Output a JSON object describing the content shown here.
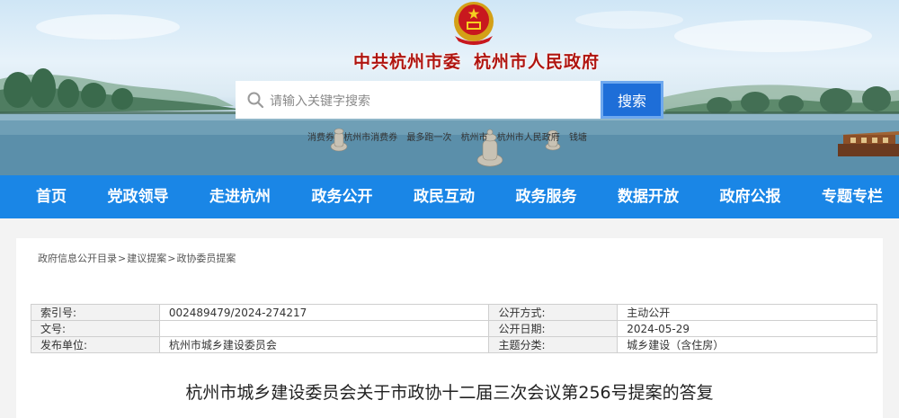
{
  "header": {
    "title_part1": "中共杭州市委",
    "title_part2": "杭州市人民政府"
  },
  "search": {
    "placeholder": "请输入关键字搜索",
    "button_label": "搜索",
    "hot_words": [
      "消费券",
      "杭州市消费券",
      "最多跑一次",
      "杭州市",
      "杭州市人民政府",
      "钱塘"
    ]
  },
  "nav": {
    "items": [
      "首页",
      "党政领导",
      "走进杭州",
      "政务公开",
      "政民互动",
      "政务服务",
      "数据开放",
      "政府公报",
      "专题专栏"
    ]
  },
  "breadcrumb": {
    "items": [
      "政府信息公开目录",
      "建议提案",
      "政协委员提案"
    ],
    "separator": ">"
  },
  "meta": {
    "rows": [
      {
        "label1": "索引号:",
        "value1": "002489479/2024-274217",
        "label2": "公开方式:",
        "value2": "主动公开"
      },
      {
        "label1": "文号:",
        "value1": "",
        "label2": "公开日期:",
        "value2": "2024-05-29"
      },
      {
        "label1": "发布单位:",
        "value1": "杭州市城乡建设委员会",
        "label2": "主题分类:",
        "value2": "城乡建设（含住房）"
      }
    ]
  },
  "document": {
    "title": "杭州市城乡建设委员会关于市政协十二届三次会议第256号提案的答复"
  },
  "colors": {
    "nav_bg": "#1a86e6",
    "search_button": "#1e6ed8",
    "title_red": "#b01510"
  }
}
